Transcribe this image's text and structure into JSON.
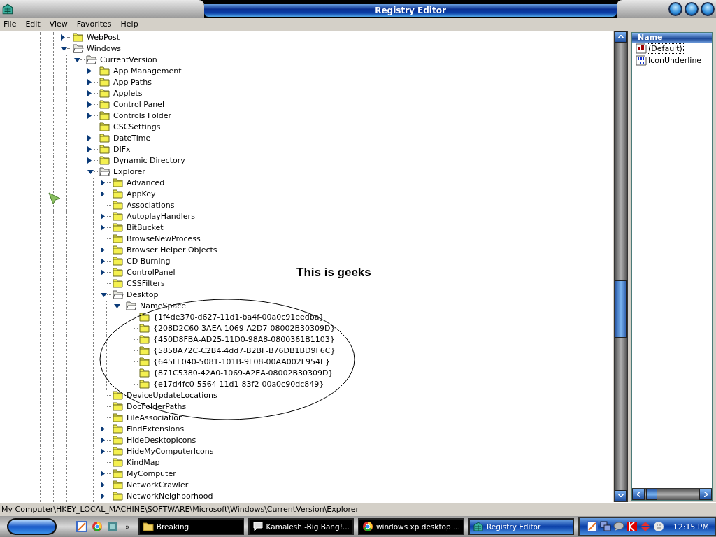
{
  "window": {
    "title": "Registry Editor"
  },
  "menu": [
    "File",
    "Edit",
    "View",
    "Favorites",
    "Help"
  ],
  "tree": [
    {
      "label": "WebPost",
      "has_children": true,
      "expanded": false
    },
    {
      "label": "Windows",
      "has_children": true,
      "expanded": true,
      "children": [
        {
          "label": "CurrentVersion",
          "has_children": true,
          "expanded": true,
          "children": [
            {
              "label": "App Management",
              "has_children": true,
              "expanded": false
            },
            {
              "label": "App Paths",
              "has_children": true,
              "expanded": false
            },
            {
              "label": "Applets",
              "has_children": true,
              "expanded": false
            },
            {
              "label": "Control Panel",
              "has_children": true,
              "expanded": false
            },
            {
              "label": "Controls Folder",
              "has_children": true,
              "expanded": false
            },
            {
              "label": "CSCSettings",
              "has_children": false
            },
            {
              "label": "DateTime",
              "has_children": true,
              "expanded": false
            },
            {
              "label": "DIFx",
              "has_children": true,
              "expanded": false
            },
            {
              "label": "Dynamic Directory",
              "has_children": true,
              "expanded": false
            },
            {
              "label": "Explorer",
              "has_children": true,
              "expanded": true,
              "children": [
                {
                  "label": "Advanced",
                  "has_children": true,
                  "expanded": false
                },
                {
                  "label": "AppKey",
                  "has_children": true,
                  "expanded": false
                },
                {
                  "label": "Associations",
                  "has_children": false
                },
                {
                  "label": "AutoplayHandlers",
                  "has_children": true,
                  "expanded": false
                },
                {
                  "label": "BitBucket",
                  "has_children": true,
                  "expanded": false
                },
                {
                  "label": "BrowseNewProcess",
                  "has_children": false
                },
                {
                  "label": "Browser Helper Objects",
                  "has_children": true,
                  "expanded": false
                },
                {
                  "label": "CD Burning",
                  "has_children": true,
                  "expanded": false
                },
                {
                  "label": "ControlPanel",
                  "has_children": true,
                  "expanded": false
                },
                {
                  "label": "CSSFilters",
                  "has_children": false
                },
                {
                  "label": "Desktop",
                  "has_children": true,
                  "expanded": true,
                  "children": [
                    {
                      "label": "NameSpace",
                      "has_children": true,
                      "expanded": true,
                      "children": [
                        {
                          "label": "{1f4de370-d627-11d1-ba4f-00a0c91eedba}",
                          "has_children": false
                        },
                        {
                          "label": "{208D2C60-3AEA-1069-A2D7-08002B30309D}",
                          "has_children": false
                        },
                        {
                          "label": "{450D8FBA-AD25-11D0-98A8-0800361B1103}",
                          "has_children": false
                        },
                        {
                          "label": "{5858A72C-C2B4-4dd7-B2BF-B76DB1BD9F6C}",
                          "has_children": false
                        },
                        {
                          "label": "{645FF040-5081-101B-9F08-00AA002F954E}",
                          "has_children": false
                        },
                        {
                          "label": "{871C5380-42A0-1069-A2EA-08002B30309D}",
                          "has_children": false
                        },
                        {
                          "label": "{e17d4fc0-5564-11d1-83f2-00a0c90dc849}",
                          "has_children": false
                        }
                      ]
                    }
                  ]
                },
                {
                  "label": "DeviceUpdateLocations",
                  "has_children": false
                },
                {
                  "label": "DocFolderPaths",
                  "has_children": false
                },
                {
                  "label": "FileAssociation",
                  "has_children": false
                },
                {
                  "label": "FindExtensions",
                  "has_children": true,
                  "expanded": false
                },
                {
                  "label": "HideDesktopIcons",
                  "has_children": true,
                  "expanded": false
                },
                {
                  "label": "HideMyComputerIcons",
                  "has_children": true,
                  "expanded": false
                },
                {
                  "label": "KindMap",
                  "has_children": false
                },
                {
                  "label": "MyComputer",
                  "has_children": true,
                  "expanded": false
                },
                {
                  "label": "NetworkCrawler",
                  "has_children": true,
                  "expanded": false
                },
                {
                  "label": "NetworkNeighborhood",
                  "has_children": true,
                  "expanded": false
                }
              ]
            }
          ]
        }
      ]
    }
  ],
  "annotation": {
    "text": "This is geeks"
  },
  "values_pane": {
    "columns": [
      "Name"
    ],
    "values": [
      {
        "name": "(Default)",
        "kind": "string",
        "selected": true
      },
      {
        "name": "IconUnderline",
        "kind": "binary",
        "selected": false
      }
    ]
  },
  "status_bar": "My Computer\\HKEY_LOCAL_MACHINE\\SOFTWARE\\Microsoft\\Windows\\CurrentVersion\\Explorer",
  "taskbar": {
    "more": "»",
    "tasks": [
      {
        "label": "Breaking",
        "kind": "folder",
        "selected": false
      },
      {
        "label": "Kamalesh -Big Bang!...",
        "kind": "chat",
        "selected": false
      },
      {
        "label": "windows xp desktop ...",
        "kind": "browser",
        "selected": false
      },
      {
        "label": "Registry Editor",
        "kind": "registry",
        "selected": true
      }
    ],
    "clock": "12:15 PM"
  }
}
